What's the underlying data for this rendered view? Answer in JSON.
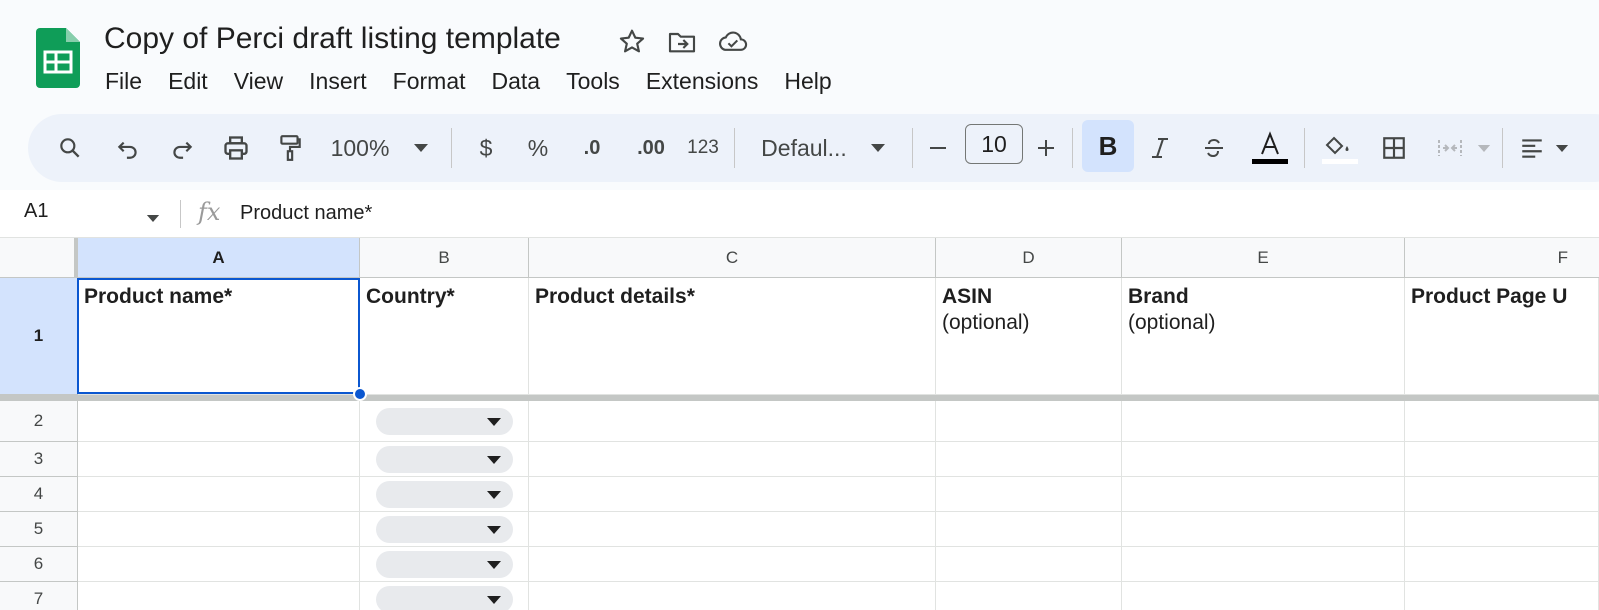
{
  "doc": {
    "title": "Copy of Perci draft listing template"
  },
  "menu": [
    "File",
    "Edit",
    "View",
    "Insert",
    "Format",
    "Data",
    "Tools",
    "Extensions",
    "Help"
  ],
  "toolbar": {
    "zoom": "100%",
    "currency": "$",
    "percent": "%",
    "decrease_decimal": ".0",
    "increase_decimal": ".00",
    "number_format": "123",
    "font": "Defaul...",
    "font_size": "10",
    "minus": "−",
    "plus": "+",
    "bold": "B"
  },
  "formula_bar": {
    "name_box": "A1",
    "fx": "fx",
    "content": "Product name*"
  },
  "columns": [
    "A",
    "B",
    "C",
    "D",
    "E",
    "F"
  ],
  "rows": [
    "1",
    "2",
    "3",
    "4",
    "5",
    "6",
    "7"
  ],
  "header_row": {
    "A": {
      "bold": "Product name*",
      "note": ""
    },
    "B": {
      "bold": "Country*",
      "note": ""
    },
    "C": {
      "bold": "Product details*",
      "note": ""
    },
    "D": {
      "bold": "ASIN",
      "note": "(optional)"
    },
    "E": {
      "bold": "Brand",
      "note": "(optional)"
    },
    "F": {
      "bold": "Product Page U",
      "note": ""
    }
  },
  "colors": {
    "accent": "#0b57d0",
    "selection": "#d3e3fd",
    "toolbar_bg": "#edf2fa",
    "sheets_green": "#0f9d58"
  },
  "icons": {
    "app": "google-sheets-logo",
    "star": "star-icon",
    "move": "move-to-folder-icon",
    "cloud": "cloud-saved-icon"
  }
}
